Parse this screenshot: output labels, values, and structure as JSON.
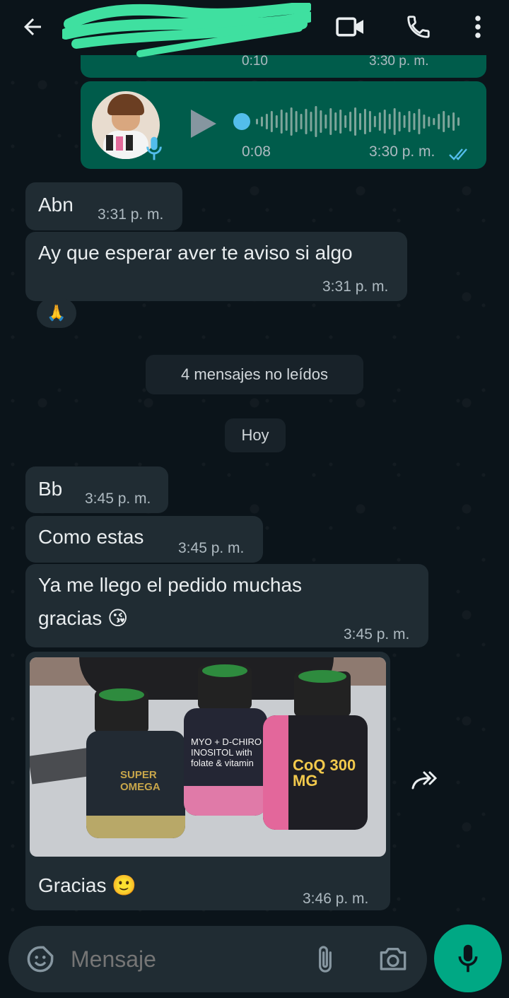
{
  "header": {
    "back_icon": "arrow-left-icon",
    "contact_name_redacted": true,
    "video_icon": "video-call-icon",
    "phone_icon": "phone-icon",
    "menu_icon": "more-vert-icon"
  },
  "voice_note_prev": {
    "duration": "0:10",
    "time": "3:30 p. m."
  },
  "voice_note": {
    "duration": "0:08",
    "time": "3:30 p. m.",
    "progress": 0,
    "status": "read"
  },
  "messages_before": [
    {
      "text": "Abn",
      "time": "3:31 p. m."
    },
    {
      "text": "Ay que esperar aver te aviso si algo",
      "time": "3:31 p. m."
    }
  ],
  "reaction": "🙏",
  "unread_label": "4 mensajes no leídos",
  "date_label": "Hoy",
  "messages_today": [
    {
      "text": "Bb",
      "time": "3:45 p. m."
    },
    {
      "text": "Como estas",
      "time": "3:45 p. m."
    },
    {
      "text_line1": "Ya me llego el pedido muchas",
      "text_line2": "gracias 😘",
      "time": "3:45 p. m."
    }
  ],
  "photo": {
    "label_bottle1": "SUPER OMEGA",
    "label_bottle2": "MYO + D-CHIRO INOSITOL with folate & vitamin",
    "label_bottle3": "CoQ 300 MG",
    "caption": "Gracias 🙂",
    "time": "3:46 p. m."
  },
  "input": {
    "placeholder": "Mensaje",
    "sticker_icon": "sticker-icon",
    "attach_icon": "paperclip-icon",
    "camera_icon": "camera-icon",
    "mic_icon": "mic-icon"
  },
  "colors": {
    "background": "#0b141a",
    "incoming_bubble": "#202c33",
    "outgoing_bubble": "#005c4b",
    "accent": "#00a884",
    "read_ticks": "#53bdeb"
  }
}
